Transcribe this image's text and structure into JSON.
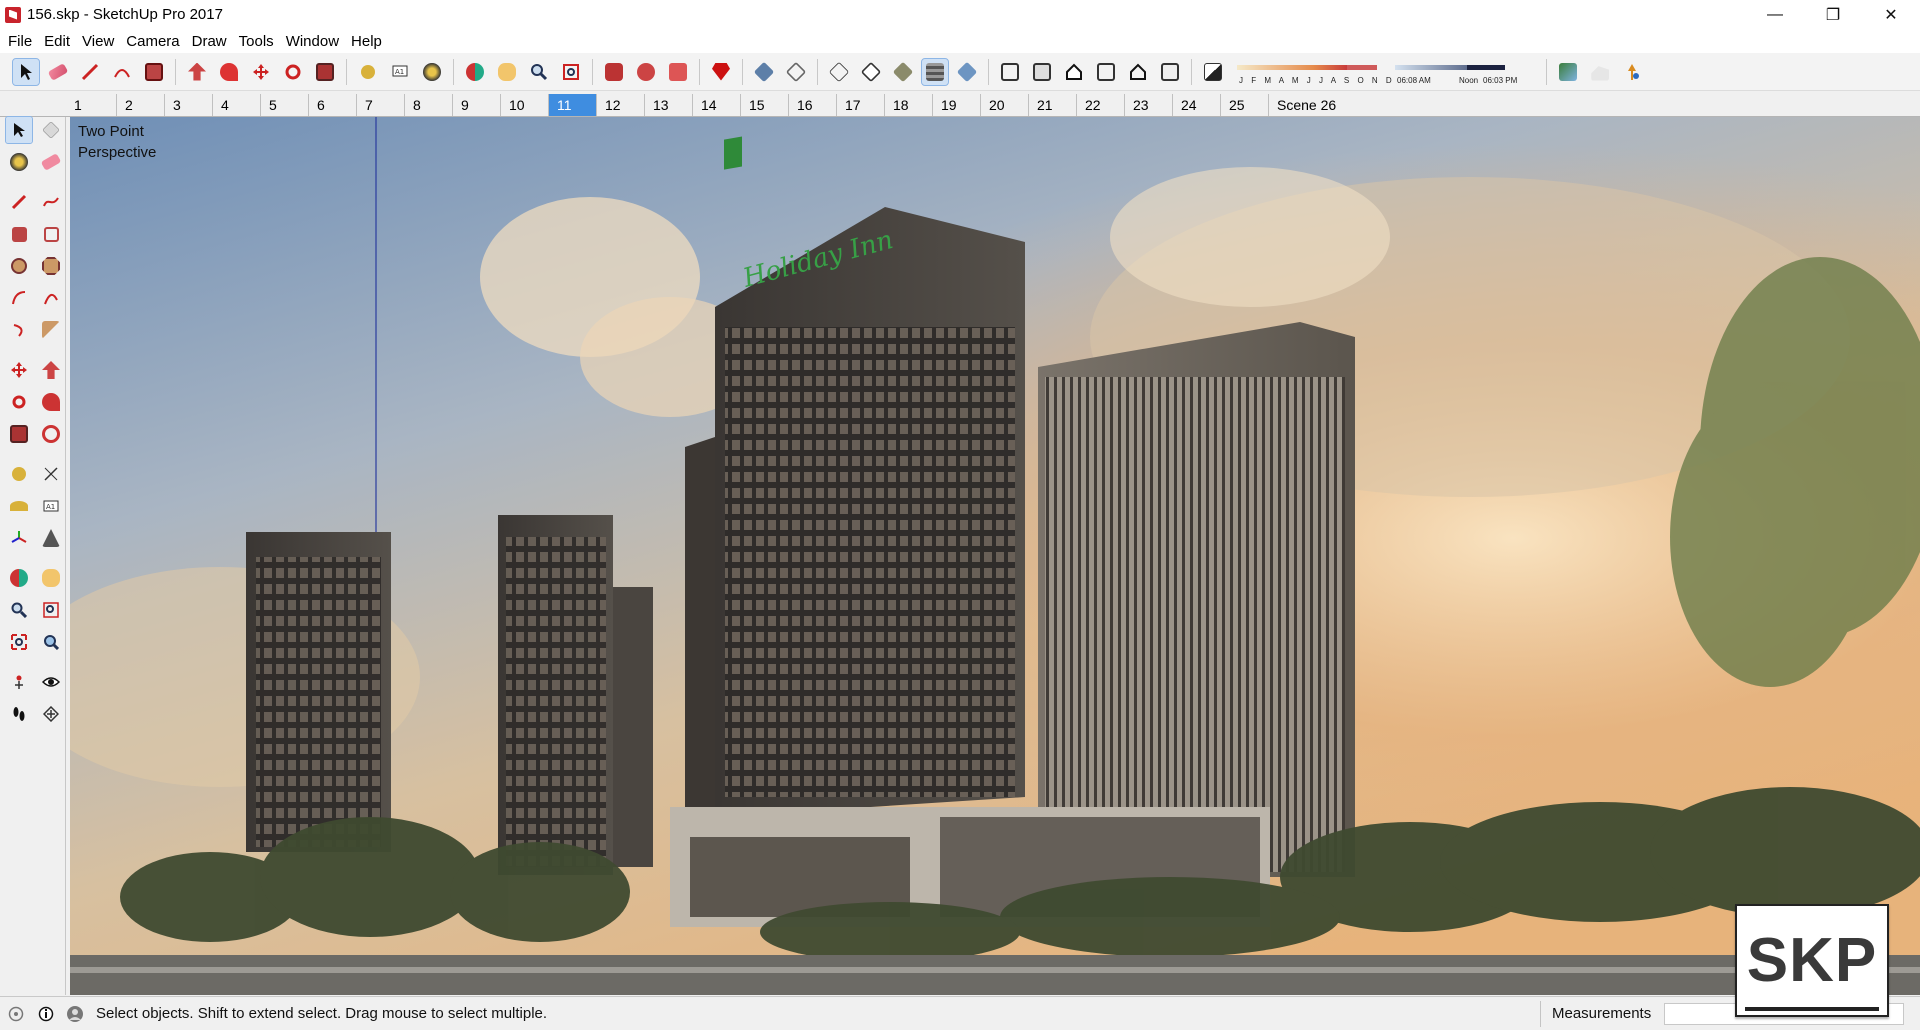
{
  "window": {
    "title": "156.skp - SketchUp Pro 2017",
    "minimize": "—",
    "maximize": "❐",
    "close": "✕"
  },
  "menu": [
    "File",
    "Edit",
    "View",
    "Camera",
    "Draw",
    "Tools",
    "Window",
    "Help"
  ],
  "shadow_settings": {
    "months": "J F M A M J J A S O N D",
    "time_start": "06:08 AM",
    "time_noon": "Noon",
    "time_end": "06:03 PM"
  },
  "scenes": {
    "tabs": [
      "1",
      "2",
      "3",
      "4",
      "5",
      "6",
      "7",
      "8",
      "9",
      "10",
      "11",
      "12",
      "13",
      "14",
      "15",
      "16",
      "17",
      "18",
      "19",
      "20",
      "21",
      "22",
      "23",
      "24",
      "25",
      "Scene 26"
    ],
    "active_index": 10
  },
  "viewport": {
    "camera_label_line1": "Two Point",
    "camera_label_line2": "Perspective",
    "building_sign": "Holiday Inn",
    "watermark": "SKP"
  },
  "status": {
    "message": "Select objects. Shift to extend select. Drag mouse to select multiple.",
    "measurements_label": "Measurements",
    "measurements_value": ""
  },
  "colors": {
    "accent_blue": "#3f8de0",
    "selection_highlight": "#cfe1f5",
    "sketchup_red": "#c8232c"
  }
}
